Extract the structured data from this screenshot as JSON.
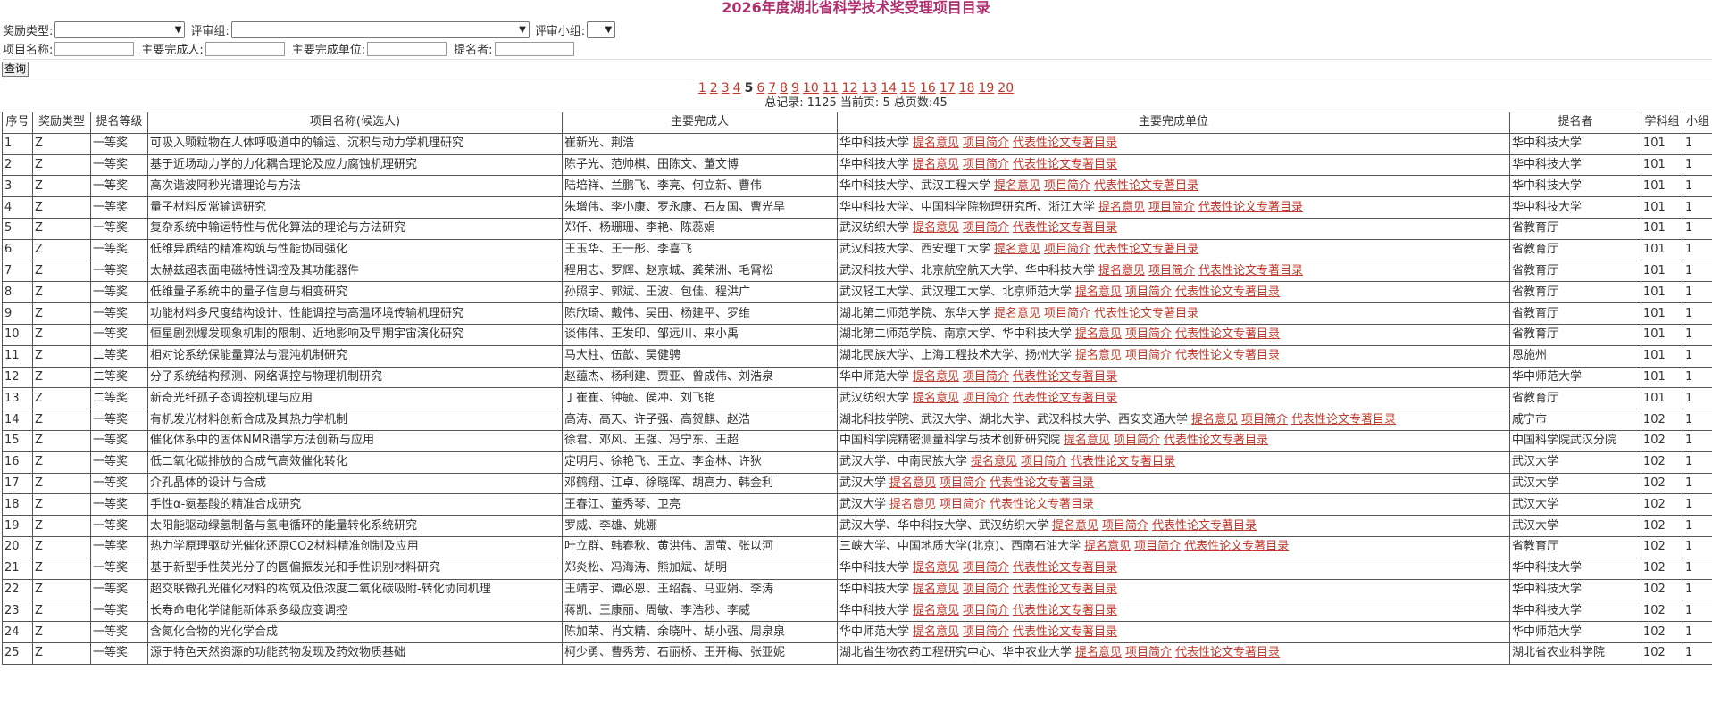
{
  "page_title": "2026年度湖北省科学技术奖受理项目目录",
  "filters": {
    "award_type_label": "奖励类型:",
    "review_group_label": "评审组:",
    "review_subgroup_label": "评审小组:",
    "project_name_label": "项目名称:",
    "main_person_label": "主要完成人:",
    "main_unit_label": "主要完成单位:",
    "nominator_label": "提名者:",
    "award_type_value": "",
    "review_group_value": "",
    "review_subgroup_value": "",
    "project_name_value": "",
    "main_person_value": "",
    "main_unit_value": "",
    "nominator_value": "",
    "query_button": "查询"
  },
  "pagination": {
    "pages": [
      "1",
      "2",
      "3",
      "4",
      "5",
      "6",
      "7",
      "8",
      "9",
      "10",
      "11",
      "12",
      "13",
      "14",
      "15",
      "16",
      "17",
      "18",
      "19",
      "20"
    ],
    "current": "5",
    "summary": "总记录: 1125  当前页: 5 总页数:45"
  },
  "table": {
    "headers": [
      "序号",
      "奖励类型",
      "提名等级",
      "项目名称(候选人)",
      "主要完成人",
      "主要完成单位",
      "提名者",
      "学科组",
      "小组"
    ],
    "link_labels": [
      "提名意见",
      "项目简介",
      "代表性论文专著目录"
    ],
    "rows": [
      {
        "no": "1",
        "type": "Z",
        "level": "一等奖",
        "name": "可吸入颗粒物在人体呼吸道中的输运、沉积与动力学机理研究",
        "persons": "崔新光、荆浩",
        "units": "华中科技大学",
        "nominator": "华中科技大学",
        "group": "101",
        "sub": "1"
      },
      {
        "no": "2",
        "type": "Z",
        "level": "一等奖",
        "name": "基于近场动力学的力化耦合理论及应力腐蚀机理研究",
        "persons": "陈子光、范帅棋、田陈文、董文博",
        "units": "华中科技大学",
        "nominator": "华中科技大学",
        "group": "101",
        "sub": "1"
      },
      {
        "no": "3",
        "type": "Z",
        "level": "一等奖",
        "name": "高次谐波阿秒光谱理论与方法",
        "persons": "陆培祥、兰鹏飞、李亮、何立新、曹伟",
        "units": "华中科技大学、武汉工程大学",
        "nominator": "华中科技大学",
        "group": "101",
        "sub": "1"
      },
      {
        "no": "4",
        "type": "Z",
        "level": "一等奖",
        "name": "量子材料反常输运研究",
        "persons": "朱增伟、李小康、罗永康、石友国、曹光旱",
        "units": "华中科技大学、中国科学院物理研究所、浙江大学",
        "nominator": "华中科技大学",
        "group": "101",
        "sub": "1"
      },
      {
        "no": "5",
        "type": "Z",
        "level": "一等奖",
        "name": "复杂系统中输运特性与优化算法的理论与方法研究",
        "persons": "郑仟、杨珊珊、李艳、陈蕊娟",
        "units": "武汉纺织大学",
        "nominator": "省教育厅",
        "group": "101",
        "sub": "1"
      },
      {
        "no": "6",
        "type": "Z",
        "level": "一等奖",
        "name": "低维异质结的精准构筑与性能协同强化",
        "persons": "王玉华、王一彤、李喜飞",
        "units": "武汉科技大学、西安理工大学",
        "nominator": "省教育厅",
        "group": "101",
        "sub": "1"
      },
      {
        "no": "7",
        "type": "Z",
        "level": "一等奖",
        "name": "太赫兹超表面电磁特性调控及其功能器件",
        "persons": "程用志、罗辉、赵京城、龚荣洲、毛霄松",
        "units": "武汉科技大学、北京航空航天大学、华中科技大学",
        "nominator": "省教育厅",
        "group": "101",
        "sub": "1"
      },
      {
        "no": "8",
        "type": "Z",
        "level": "一等奖",
        "name": "低维量子系统中的量子信息与相变研究",
        "persons": "孙照宇、郭斌、王波、包佳、程洪广",
        "units": "武汉轻工大学、武汉理工大学、北京师范大学",
        "nominator": "省教育厅",
        "group": "101",
        "sub": "1"
      },
      {
        "no": "9",
        "type": "Z",
        "level": "一等奖",
        "name": "功能材料多尺度结构设计、性能调控与高温环境传输机理研究",
        "persons": "陈欣琦、戴伟、吴田、杨建平、罗维",
        "units": "湖北第二师范学院、东华大学",
        "nominator": "省教育厅",
        "group": "101",
        "sub": "1"
      },
      {
        "no": "10",
        "type": "Z",
        "level": "一等奖",
        "name": "恒星剧烈爆发现象机制的限制、近地影响及早期宇宙演化研究",
        "persons": "谈伟伟、王发印、邹远川、来小禹",
        "units": "湖北第二师范学院、南京大学、华中科技大学",
        "nominator": "省教育厅",
        "group": "101",
        "sub": "1"
      },
      {
        "no": "11",
        "type": "Z",
        "level": "二等奖",
        "name": "相对论系统保能量算法与混沌机制研究",
        "persons": "马大柱、伍歆、吴健骋",
        "units": "湖北民族大学、上海工程技术大学、扬州大学",
        "nominator": "恩施州",
        "group": "101",
        "sub": "1"
      },
      {
        "no": "12",
        "type": "Z",
        "level": "二等奖",
        "name": "分子系统结构预测、网络调控与物理机制研究",
        "persons": "赵蕴杰、杨利建、贾亚、曾成伟、刘浩泉",
        "units": "华中师范大学",
        "nominator": "华中师范大学",
        "group": "101",
        "sub": "1"
      },
      {
        "no": "13",
        "type": "Z",
        "level": "二等奖",
        "name": "新奇光纤孤子态调控机理与应用",
        "persons": "丁崔崔、钟毓、侯冲、刘飞艳",
        "units": "武汉纺织大学",
        "nominator": "省教育厅",
        "group": "101",
        "sub": "1"
      },
      {
        "no": "14",
        "type": "Z",
        "level": "一等奖",
        "name": "有机发光材料创新合成及其热力学机制",
        "persons": "高涛、高天、许子强、高贺麒、赵浩",
        "units": "湖北科技学院、武汉大学、湖北大学、武汉科技大学、西安交通大学",
        "nominator": "咸宁市",
        "group": "102",
        "sub": "1"
      },
      {
        "no": "15",
        "type": "Z",
        "level": "一等奖",
        "name": "催化体系中的固体NMR谱学方法创新与应用",
        "persons": "徐君、邓风、王强、冯宁东、王超",
        "units": "中国科学院精密测量科学与技术创新研究院",
        "nominator": "中国科学院武汉分院",
        "group": "102",
        "sub": "1"
      },
      {
        "no": "16",
        "type": "Z",
        "level": "一等奖",
        "name": "低二氧化碳排放的合成气高效催化转化",
        "persons": "定明月、徐艳飞、王立、李金林、许狄",
        "units": "武汉大学、中南民族大学",
        "nominator": "武汉大学",
        "group": "102",
        "sub": "1"
      },
      {
        "no": "17",
        "type": "Z",
        "level": "一等奖",
        "name": "介孔晶体的设计与合成",
        "persons": "邓鹤翔、江卓、徐晓晖、胡高力、韩金利",
        "units": "武汉大学",
        "nominator": "武汉大学",
        "group": "102",
        "sub": "1"
      },
      {
        "no": "18",
        "type": "Z",
        "level": "一等奖",
        "name": "手性α-氨基酸的精准合成研究",
        "persons": "王春江、董秀琴、卫亮",
        "units": "武汉大学",
        "nominator": "武汉大学",
        "group": "102",
        "sub": "1"
      },
      {
        "no": "19",
        "type": "Z",
        "level": "一等奖",
        "name": "太阳能驱动绿氢制备与氢电循环的能量转化系统研究",
        "persons": "罗威、李雄、姚娜",
        "units": "武汉大学、华中科技大学、武汉纺织大学",
        "nominator": "武汉大学",
        "group": "102",
        "sub": "1"
      },
      {
        "no": "20",
        "type": "Z",
        "level": "一等奖",
        "name": "热力学原理驱动光催化还原CO2材料精准创制及应用",
        "persons": "叶立群、韩春秋、黄洪伟、周萤、张以河",
        "units": "三峡大学、中国地质大学(北京)、西南石油大学",
        "nominator": "省教育厅",
        "group": "102",
        "sub": "1"
      },
      {
        "no": "21",
        "type": "Z",
        "level": "一等奖",
        "name": "基于新型手性荧光分子的圆偏振发光和手性识别材料研究",
        "persons": "郑炎松、冯海涛、熊加斌、胡明",
        "units": "华中科技大学",
        "nominator": "华中科技大学",
        "group": "102",
        "sub": "1"
      },
      {
        "no": "22",
        "type": "Z",
        "level": "一等奖",
        "name": "超交联微孔光催化材料的构筑及低浓度二氧化碳吸附-转化协同机理",
        "persons": "王靖宇、谭必恩、王绍磊、马亚娟、李涛",
        "units": "华中科技大学",
        "nominator": "华中科技大学",
        "group": "102",
        "sub": "1"
      },
      {
        "no": "23",
        "type": "Z",
        "level": "一等奖",
        "name": "长寿命电化学储能新体系多级应变调控",
        "persons": "蒋凯、王康丽、周敏、李浩秒、李威",
        "units": "华中科技大学",
        "nominator": "华中科技大学",
        "group": "102",
        "sub": "1"
      },
      {
        "no": "24",
        "type": "Z",
        "level": "一等奖",
        "name": "含氮化合物的光化学合成",
        "persons": "陈加荣、肖文精、余晓叶、胡小强、周泉泉",
        "units": "华中师范大学",
        "nominator": "华中师范大学",
        "group": "102",
        "sub": "1"
      },
      {
        "no": "25",
        "type": "Z",
        "level": "一等奖",
        "name": "源于特色天然资源的功能药物发现及药效物质基础",
        "persons": "柯少勇、曹秀芳、石丽桥、王开梅、张亚妮",
        "units": "湖北省生物农药工程研究中心、华中农业大学",
        "nominator": "湖北省农业科学院",
        "group": "102",
        "sub": "1"
      }
    ]
  }
}
